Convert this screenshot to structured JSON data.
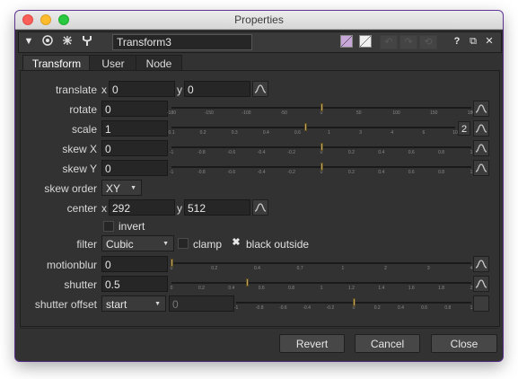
{
  "window": {
    "title": "Properties"
  },
  "toolbar": {
    "node_name": "Transform3",
    "icons": [
      "collapse-arrow-icon",
      "view-node-icon",
      "centralize-icon",
      "wrench-icon",
      "node-color-icon",
      "text-color-icon",
      "undo-icon",
      "redo-icon",
      "revert-icon",
      "help-icon",
      "float-icon",
      "close-icon"
    ],
    "help_label": "?",
    "float_label": "⧉",
    "close_label": "✕"
  },
  "tabs": [
    {
      "label": "Transform",
      "active": true
    },
    {
      "label": "User",
      "active": false
    },
    {
      "label": "Node",
      "active": false
    }
  ],
  "knobs": {
    "translate": {
      "label": "translate",
      "x_label": "x",
      "x": "0",
      "y_label": "y",
      "y": "0"
    },
    "rotate": {
      "label": "rotate",
      "value": "0",
      "slider_ticks": [
        "-180",
        "-150",
        "-100",
        "-50",
        "0",
        "50",
        "100",
        "150",
        "180"
      ],
      "slider_pos": 0.5
    },
    "scale": {
      "label": "scale",
      "value": "1",
      "scale_btn": "2",
      "slider_ticks": [
        "0.1",
        "0.2",
        "0.3",
        "0.4",
        "0.6",
        "1",
        "3",
        "4",
        "6",
        "10"
      ],
      "slider_pos": 0.47
    },
    "skew_x": {
      "label": "skew X",
      "value": "0",
      "slider_ticks": [
        "-1",
        "-0.8",
        "-0.6",
        "-0.4",
        "-0.2",
        "0",
        "0.2",
        "0.4",
        "0.6",
        "0.8",
        "1"
      ],
      "slider_pos": 0.5
    },
    "skew_y": {
      "label": "skew Y",
      "value": "0",
      "slider_ticks": [
        "-1",
        "-0.8",
        "-0.6",
        "-0.4",
        "-0.2",
        "0",
        "0.2",
        "0.4",
        "0.6",
        "0.8",
        "1"
      ],
      "slider_pos": 0.5
    },
    "skew_order": {
      "label": "skew order",
      "value": "XY"
    },
    "center": {
      "label": "center",
      "x_label": "x",
      "x": "292",
      "y_label": "y",
      "y": "512"
    },
    "invert": {
      "label": "invert",
      "checked": false
    },
    "filter": {
      "label": "filter",
      "value": "Cubic",
      "clamp_label": "clamp",
      "clamp_checked": false,
      "black_outside_label": "black outside",
      "black_outside_checked": true
    },
    "motionblur": {
      "label": "motionblur",
      "value": "0",
      "slider_ticks": [
        "0",
        "0.2",
        "0.4",
        "0.7",
        "1",
        "2",
        "3",
        "4"
      ],
      "slider_pos": 0.0
    },
    "shutter": {
      "label": "shutter",
      "value": "0.5",
      "slider_ticks": [
        "0",
        "0.2",
        "0.4",
        "0.6",
        "0.8",
        "1",
        "1.2",
        "1.4",
        "1.6",
        "1.8",
        "2"
      ],
      "slider_pos": 0.25
    },
    "shutter_offset": {
      "label": "shutter offset",
      "value": "start",
      "custom_value": "0",
      "slider_ticks": [
        "-1",
        "-0.8",
        "-0.6",
        "-0.4",
        "-0.2",
        "0",
        "0.2",
        "0.4",
        "0.6",
        "0.8",
        "1"
      ],
      "slider_pos": 0.5
    }
  },
  "buttons": {
    "revert": "Revert",
    "cancel": "Cancel",
    "close": "Close"
  },
  "colors": {
    "background": "#323232",
    "field": "#262626",
    "slider_handle": "#c2a460",
    "accent_border": "#6a3aa6"
  }
}
